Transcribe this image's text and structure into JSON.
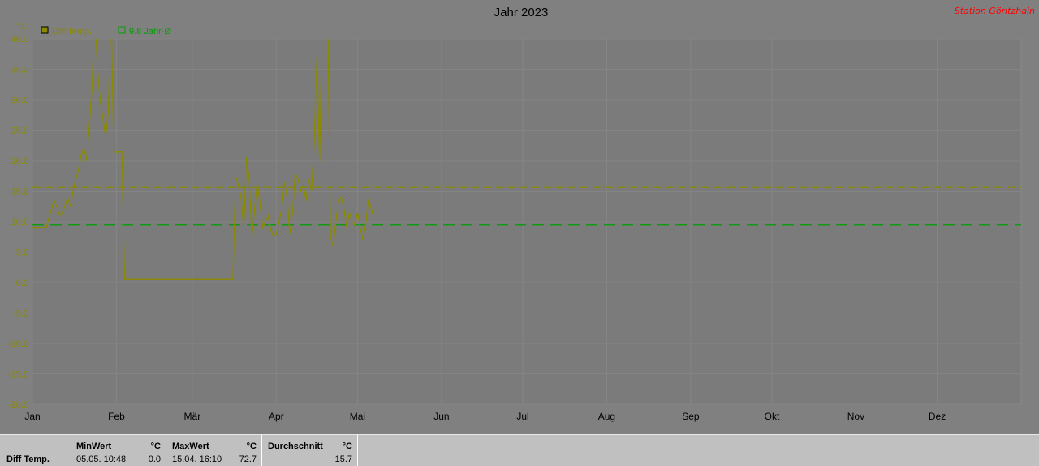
{
  "title": "Jahr 2023",
  "station": "Station Göritzhain",
  "y_unit": "°C",
  "legend": [
    {
      "label": "Diff Temp.",
      "color": "#8a8a00"
    },
    {
      "label": "9.8 Jahr-Ø",
      "color": "#00a000"
    }
  ],
  "chart_data": {
    "type": "line",
    "title": "Jahr 2023",
    "ylabel": "°C",
    "ylim": [
      -20,
      40
    ],
    "yticks": [
      "40.0",
      "35.0",
      "30.0",
      "25.0",
      "20.0",
      "15.0",
      "10.0",
      "5.0",
      "0.0",
      "-5.0",
      "-10.0",
      "-15.0",
      "-20.0"
    ],
    "x_months": [
      "Jan",
      "Feb",
      "Mär",
      "Apr",
      "Mai",
      "Jun",
      "Jul",
      "Aug",
      "Sep",
      "Okt",
      "Nov",
      "Dez"
    ],
    "series": [
      {
        "name": "Diff Temp.",
        "color": "#8a8a00",
        "x_day": [
          1,
          4,
          5,
          6,
          7,
          8,
          9,
          10,
          11,
          12,
          13,
          14,
          15,
          16,
          17,
          18,
          19,
          20,
          21,
          22,
          23,
          24,
          25,
          26,
          27,
          28,
          29,
          30,
          31,
          32,
          33,
          34,
          35,
          36,
          37,
          38,
          39,
          40,
          41,
          42,
          43,
          44,
          45,
          46,
          47,
          48,
          49,
          50,
          51,
          52,
          53,
          54,
          55,
          56,
          57,
          58,
          59,
          60,
          61,
          62,
          63,
          64,
          65,
          66,
          67,
          68,
          69,
          70,
          71,
          72,
          73,
          74,
          75,
          76,
          77,
          78,
          79,
          80,
          81,
          82,
          83,
          84,
          85,
          86,
          87,
          88,
          89,
          90,
          91,
          92,
          93,
          94,
          95,
          96,
          97,
          98,
          99,
          100,
          101,
          102,
          103,
          104,
          105,
          106,
          107,
          108,
          109,
          110,
          111,
          112,
          113,
          114,
          115,
          116,
          117,
          118,
          119,
          120,
          121,
          122,
          123,
          124,
          125,
          126,
          127,
          128,
          129,
          130,
          131,
          132,
          133,
          134,
          135,
          136,
          137
        ],
        "y": [
          9.0,
          9.0,
          9.0,
          9.0,
          10.5,
          12.0,
          13.5,
          12.5,
          11.0,
          11.5,
          12.5,
          14.0,
          12.5,
          15.0,
          17.0,
          18.5,
          21.0,
          22.0,
          20.0,
          26.0,
          32.0,
          45.0,
          35.0,
          30.0,
          27.0,
          24.0,
          28.0,
          45.0,
          21.5,
          21.5,
          21.5,
          21.5,
          0.5,
          0.5,
          0.5,
          0.5,
          0.5,
          0.5,
          0.5,
          0.5,
          0.5,
          0.5,
          0.5,
          0.5,
          0.5,
          0.5,
          0.5,
          0.5,
          0.5,
          0.5,
          0.5,
          0.5,
          0.5,
          0.5,
          0.5,
          0.5,
          0.5,
          0.5,
          0.5,
          0.5,
          0.5,
          0.5,
          0.5,
          0.5,
          0.5,
          0.5,
          0.5,
          0.5,
          0.5,
          0.5,
          0.5,
          0.5,
          0.5,
          17.5,
          16.0,
          14.0,
          9.0,
          20.5,
          17.0,
          7.5,
          12.0,
          16.5,
          13.0,
          9.0,
          10.0,
          11.0,
          8.5,
          7.5,
          8.0,
          10.0,
          12.0,
          16.5,
          14.0,
          8.0,
          11.5,
          18.0,
          17.0,
          15.0,
          16.0,
          13.5,
          17.0,
          15.0,
          23.0,
          37.0,
          20.0,
          45.0,
          40.0,
          45.0,
          7.5,
          6.0,
          10.0,
          13.5,
          14.0,
          12.0,
          9.0,
          11.5,
          10.0,
          9.5,
          11.5,
          9.0,
          7.0,
          9.5,
          13.5,
          12.5,
          10.5
        ]
      }
    ],
    "reference_lines": [
      {
        "name": "Durchschnitt",
        "y": 15.7,
        "color": "#8a8a00",
        "style": "dashed"
      },
      {
        "name": "9.8 Jahr-Ø",
        "y": 9.5,
        "color": "#00a000",
        "style": "dashed"
      }
    ],
    "grid": true,
    "legend_position": "top-left"
  },
  "stats": {
    "row_label": "Diff Temp.",
    "unit": "°C",
    "min": {
      "header": "MinWert",
      "date": "05.05.  10:48",
      "value": "0.0"
    },
    "max": {
      "header": "MaxWert",
      "date": "15.04.  16:10",
      "value": "72.7"
    },
    "avg": {
      "header": "Durchschnitt",
      "value": "15.7"
    }
  }
}
